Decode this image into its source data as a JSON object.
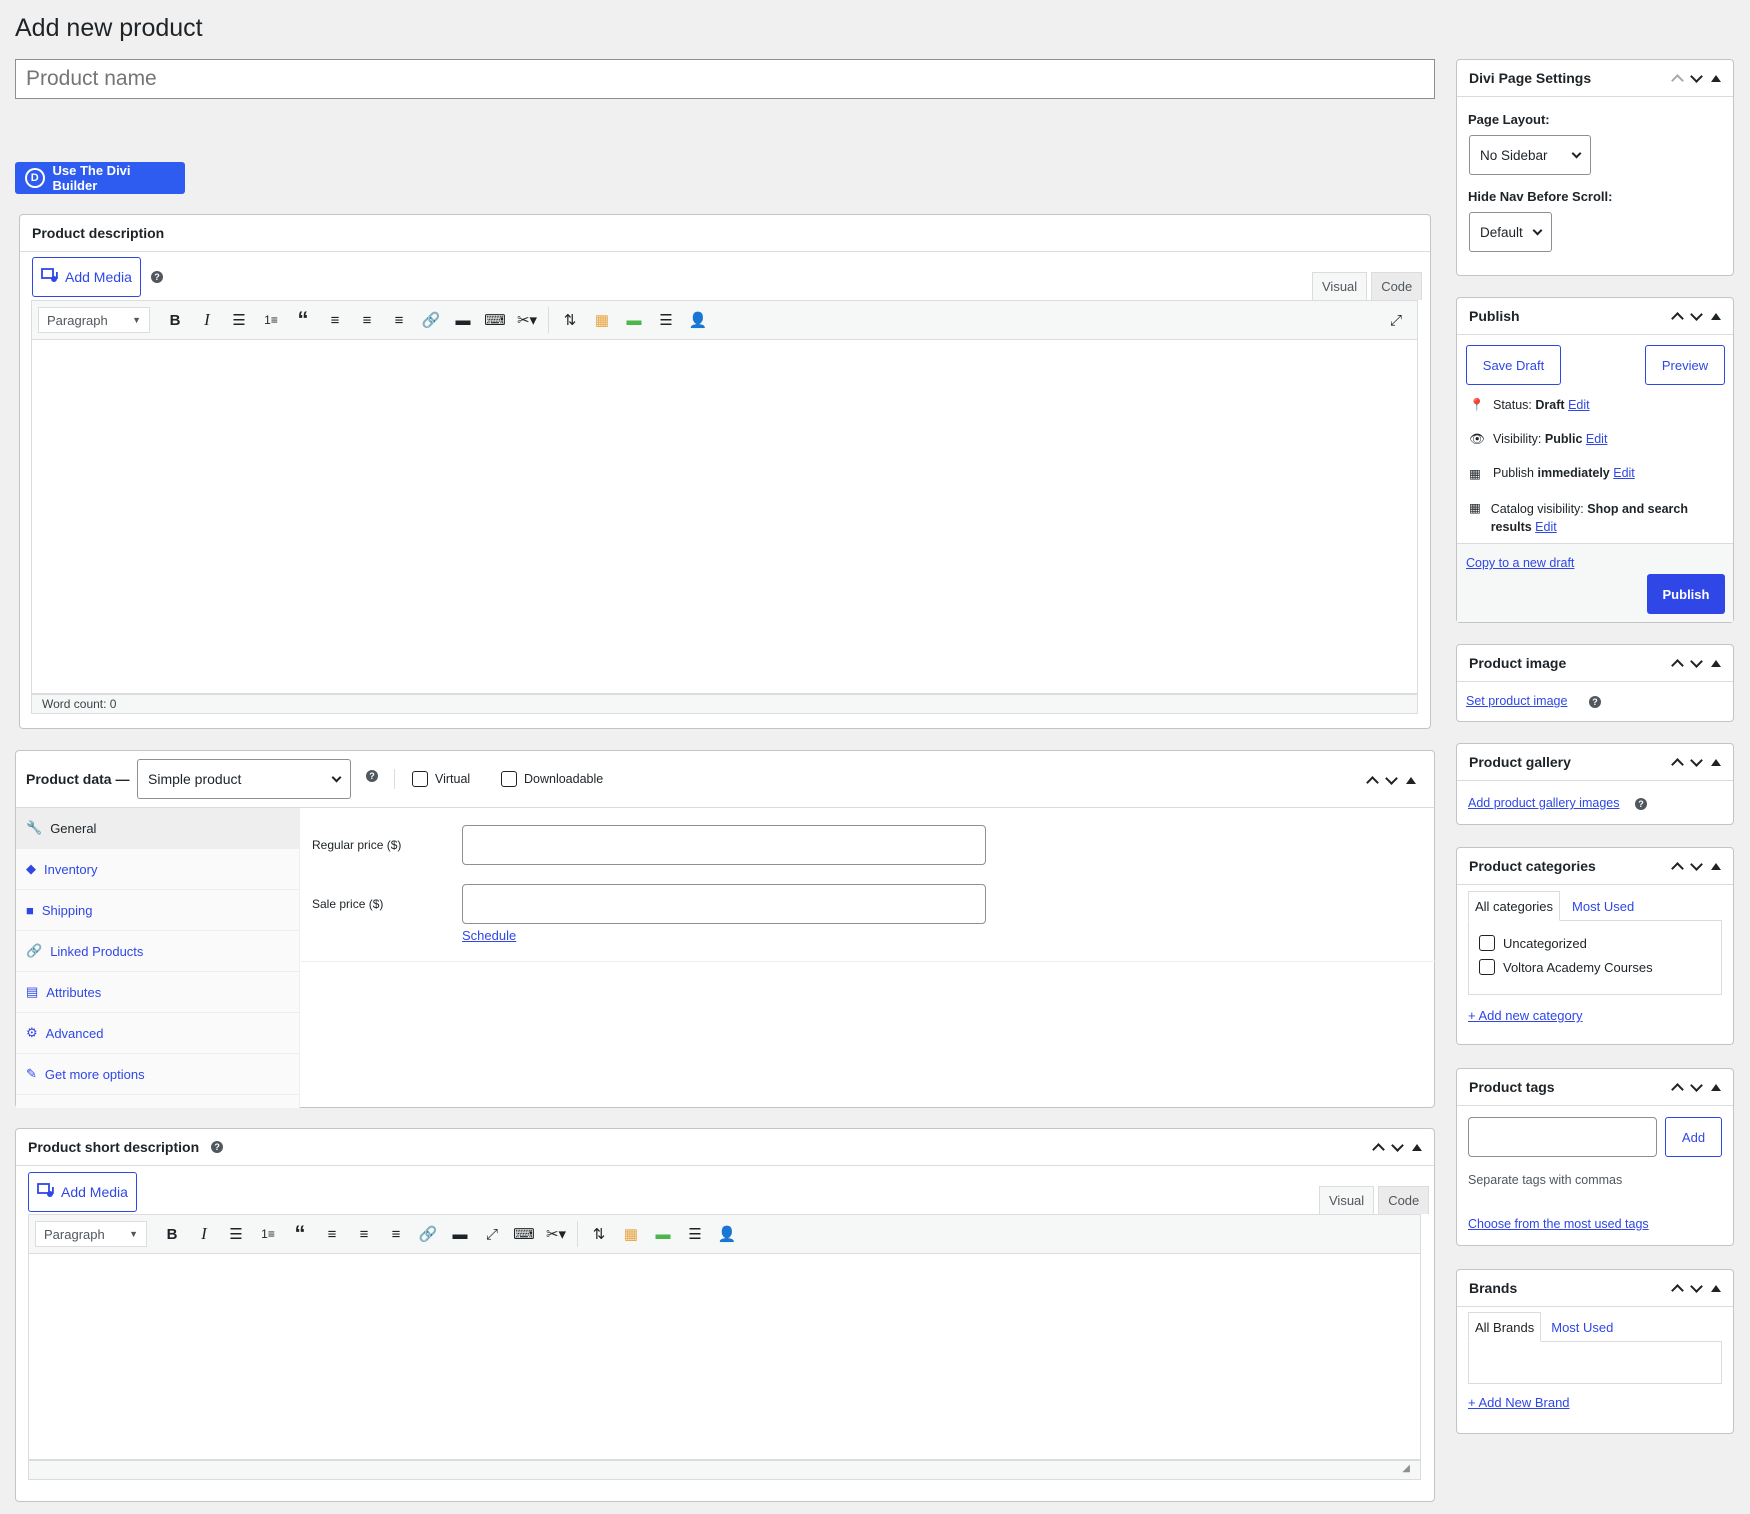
{
  "title": "Add new product",
  "product_name_placeholder": "Product name",
  "divi_builder_button": "Use The Divi Builder",
  "divi_logo_letter": "D",
  "product_description": {
    "header": "Product description",
    "add_media": "Add Media",
    "tab_visual": "Visual",
    "tab_code": "Code",
    "format_select": "Paragraph",
    "word_count": "Word count: 0"
  },
  "product_data": {
    "label": "Product data —",
    "type_select": "Simple product",
    "virtual_label": "Virtual",
    "downloadable_label": "Downloadable",
    "nav": [
      {
        "label": "General",
        "icon": "wrench-icon"
      },
      {
        "label": "Inventory",
        "icon": "tag-icon"
      },
      {
        "label": "Shipping",
        "icon": "truck-icon"
      },
      {
        "label": "Linked Products",
        "icon": "link-icon"
      },
      {
        "label": "Attributes",
        "icon": "list-icon"
      },
      {
        "label": "Advanced",
        "icon": "gear-icon"
      },
      {
        "label": "Get more options",
        "icon": "plugin-icon"
      }
    ],
    "regular_price_label": "Regular price ($)",
    "sale_price_label": "Sale price ($)",
    "schedule_link": "Schedule"
  },
  "short_description": {
    "header": "Product short description",
    "add_media": "Add Media",
    "tab_visual": "Visual",
    "tab_code": "Code",
    "format_select": "Paragraph"
  },
  "sidebar": {
    "divi_settings": {
      "header": "Divi Page Settings",
      "page_layout_label": "Page Layout:",
      "page_layout_value": "No Sidebar",
      "hide_nav_label": "Hide Nav Before Scroll:",
      "hide_nav_value": "Default"
    },
    "publish": {
      "header": "Publish",
      "save_draft": "Save Draft",
      "preview": "Preview",
      "status_label": "Status:",
      "status_value": "Draft",
      "visibility_label": "Visibility:",
      "visibility_value": "Public",
      "publish_label": "Publish",
      "publish_value": "immediately",
      "catalog_label": "Catalog visibility:",
      "catalog_value": "Shop and search results",
      "edit": "Edit",
      "copy_draft": "Copy to a new draft",
      "publish_button": "Publish"
    },
    "product_image": {
      "header": "Product image",
      "link": "Set product image"
    },
    "product_gallery": {
      "header": "Product gallery",
      "link": "Add product gallery images"
    },
    "product_categories": {
      "header": "Product categories",
      "tab_all": "All categories",
      "tab_most_used": "Most Used",
      "items": [
        "Uncategorized",
        "Voltora Academy Courses"
      ],
      "add_new": "+ Add new category"
    },
    "product_tags": {
      "header": "Product tags",
      "add_button": "Add",
      "hint": "Separate tags with commas",
      "choose_link": "Choose from the most used tags"
    },
    "brands": {
      "header": "Brands",
      "tab_all": "All Brands",
      "tab_most_used": "Most Used",
      "add_new": "+ Add New Brand"
    }
  },
  "colors": {
    "accent": "#2f47e6",
    "divi_button": "#2f5cf0",
    "background": "#f0f0f1"
  }
}
